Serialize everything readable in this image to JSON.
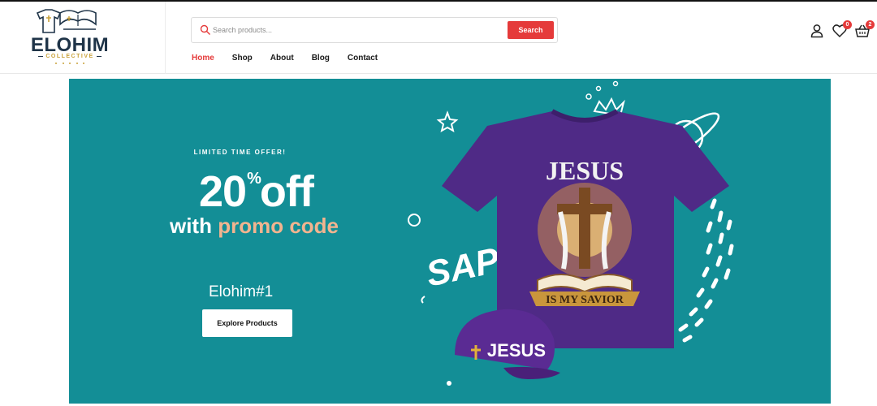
{
  "brand": {
    "name": "ELOHIM",
    "tagline": "COLLECTIVE"
  },
  "search": {
    "placeholder": "Search products...",
    "button_label": "Search"
  },
  "nav": {
    "items": [
      {
        "label": "Home",
        "active": true
      },
      {
        "label": "Shop",
        "active": false
      },
      {
        "label": "About",
        "active": false
      },
      {
        "label": "Blog",
        "active": false
      },
      {
        "label": "Contact",
        "active": false
      }
    ]
  },
  "header_icons": {
    "account_icon": "user-icon",
    "wishlist_icon": "heart-icon",
    "wishlist_count": "0",
    "cart_icon": "basket-icon",
    "cart_count": "2"
  },
  "hero": {
    "kicker": "LIMITED TIME OFFER!",
    "discount_number": "20",
    "discount_percent": "%",
    "discount_word": "off",
    "line_prefix": "with",
    "line_highlight": "promo code",
    "code": "Elohim#1",
    "cta_label": "Explore Products",
    "shirt_text_top": "JESUS",
    "shirt_text_banner": "IS MY SAVIOR",
    "cap_text": "JESUS",
    "doodle_text": "SAP"
  },
  "colors": {
    "accent": "#e53a3a",
    "hero_bg": "#138e96",
    "promo_highlight": "#f2b48f",
    "shirt": "#4f2a86",
    "brand_navy": "#1f3448",
    "brand_gold": "#c9a23a"
  }
}
